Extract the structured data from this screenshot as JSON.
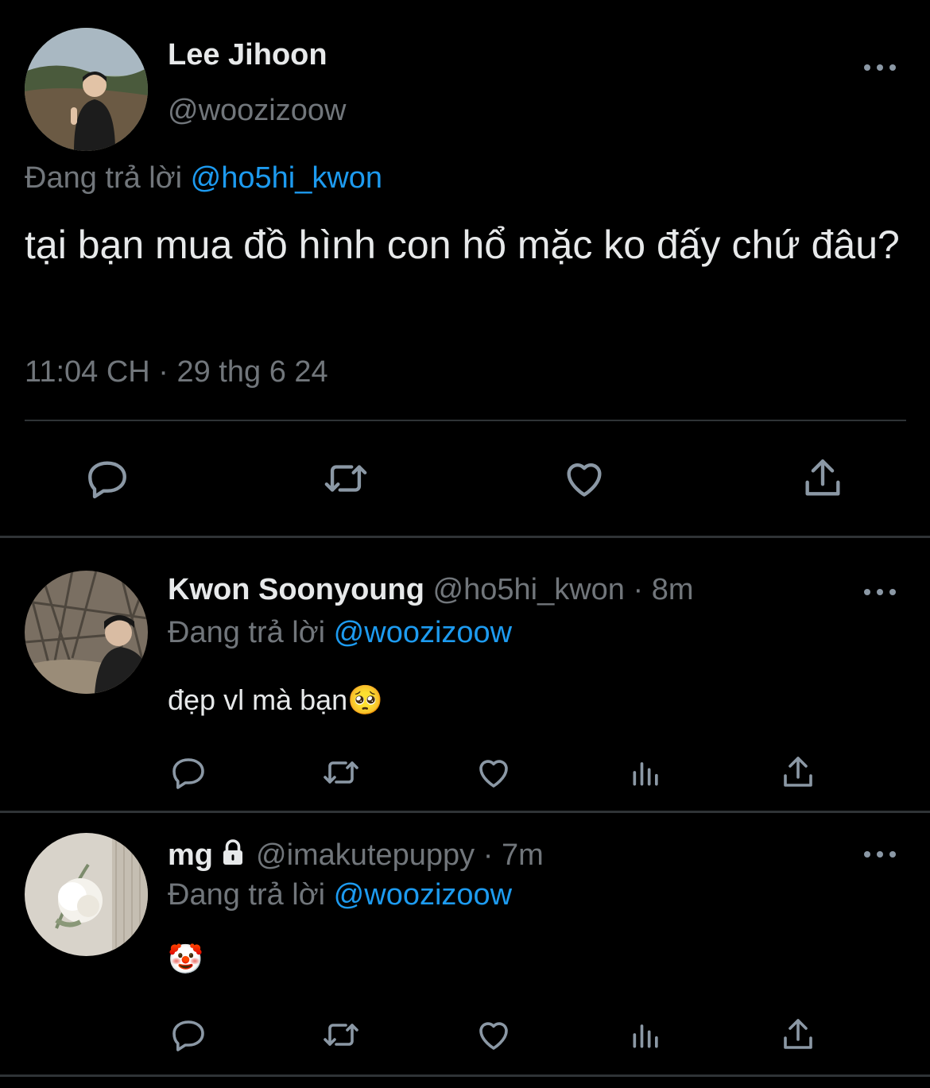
{
  "main_tweet": {
    "display_name": "Lee Jihoon",
    "handle": "@woozizoow",
    "replying_to_label": "Đang trả lời",
    "replying_to_handle": "@ho5hi_kwon",
    "text": "tại bạn mua đồ hình con hổ mặc ko đấy chứ đâu?",
    "timestamp": "11:04 CH · 29 thg 6 24",
    "avatar_icon": "avatar-lee-jihoon",
    "actions": [
      "reply-icon",
      "retweet-icon",
      "like-icon",
      "share-icon"
    ]
  },
  "replies": [
    {
      "display_name": "Kwon Soonyoung",
      "handle": "@ho5hi_kwon",
      "time": "· 8m",
      "replying_to_label": "Đang trả lời",
      "replying_to_handle": "@woozizoow",
      "text": "đẹp vl mà bạn🥺",
      "protected": false,
      "avatar_icon": "avatar-kwon-soonyoung",
      "actions": [
        "reply-icon",
        "retweet-icon",
        "like-icon",
        "views-icon",
        "share-icon"
      ]
    },
    {
      "display_name": "mg",
      "handle": "@imakutepuppy",
      "time": "· 7m",
      "replying_to_label": "Đang trả lời",
      "replying_to_handle": "@woozizoow",
      "text": "🤡",
      "protected": true,
      "avatar_icon": "avatar-mg-rose",
      "actions": [
        "reply-icon",
        "retweet-icon",
        "like-icon",
        "views-icon",
        "share-icon"
      ]
    }
  ],
  "colors": {
    "background": "#000000",
    "text": "#e7e9ea",
    "muted": "#71767b",
    "link": "#1d9bf0",
    "divider": "#2f3336"
  }
}
